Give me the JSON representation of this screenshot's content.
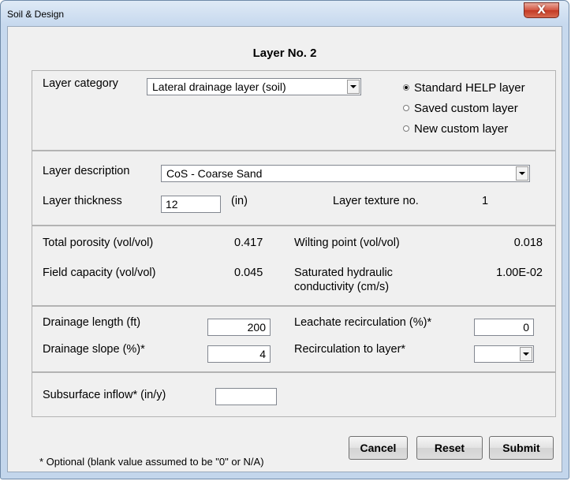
{
  "window": {
    "title": "Soil & Design",
    "close_glyph": "X"
  },
  "heading": "Layer No. 2",
  "category": {
    "label": "Layer category",
    "value": "Lateral drainage layer (soil)",
    "radios": [
      {
        "label": "Standard HELP layer",
        "selected": true
      },
      {
        "label": "Saved custom layer",
        "selected": false
      },
      {
        "label": "New custom layer",
        "selected": false
      }
    ]
  },
  "description": {
    "label": "Layer description",
    "value": "CoS - Coarse Sand",
    "thickness_label": "Layer thickness",
    "thickness_value": "12",
    "thickness_unit": "(in)",
    "texture_label": "Layer texture no.",
    "texture_value": "1"
  },
  "properties": {
    "total_porosity_label": "Total porosity (vol/vol)",
    "total_porosity_value": "0.417",
    "wilting_point_label": "Wilting point (vol/vol)",
    "wilting_point_value": "0.018",
    "field_capacity_label": "Field capacity (vol/vol)",
    "field_capacity_value": "0.045",
    "sat_hyd_label_line1": "Saturated hydraulic",
    "sat_hyd_label_line2": "conductivity (cm/s)",
    "sat_hyd_value": "1.00E-02"
  },
  "drainage": {
    "length_label": "Drainage length (ft)",
    "length_value": "200",
    "slope_label": "Drainage slope (%)*",
    "slope_value": "4",
    "leachate_label": "Leachate recirculation (%)*",
    "leachate_value": "0",
    "recirc_layer_label": "Recirculation to layer*",
    "recirc_layer_value": ""
  },
  "subsurface": {
    "label": "Subsurface inflow*  (in/y)",
    "value": ""
  },
  "footer_note": "* Optional (blank value assumed to be \"0\" or N/A)",
  "buttons": {
    "cancel": "Cancel",
    "reset": "Reset",
    "submit": "Submit"
  },
  "colors": {
    "frame": "#c3d6ec",
    "client": "#f0f0f0",
    "close_button": "#c33a24"
  }
}
